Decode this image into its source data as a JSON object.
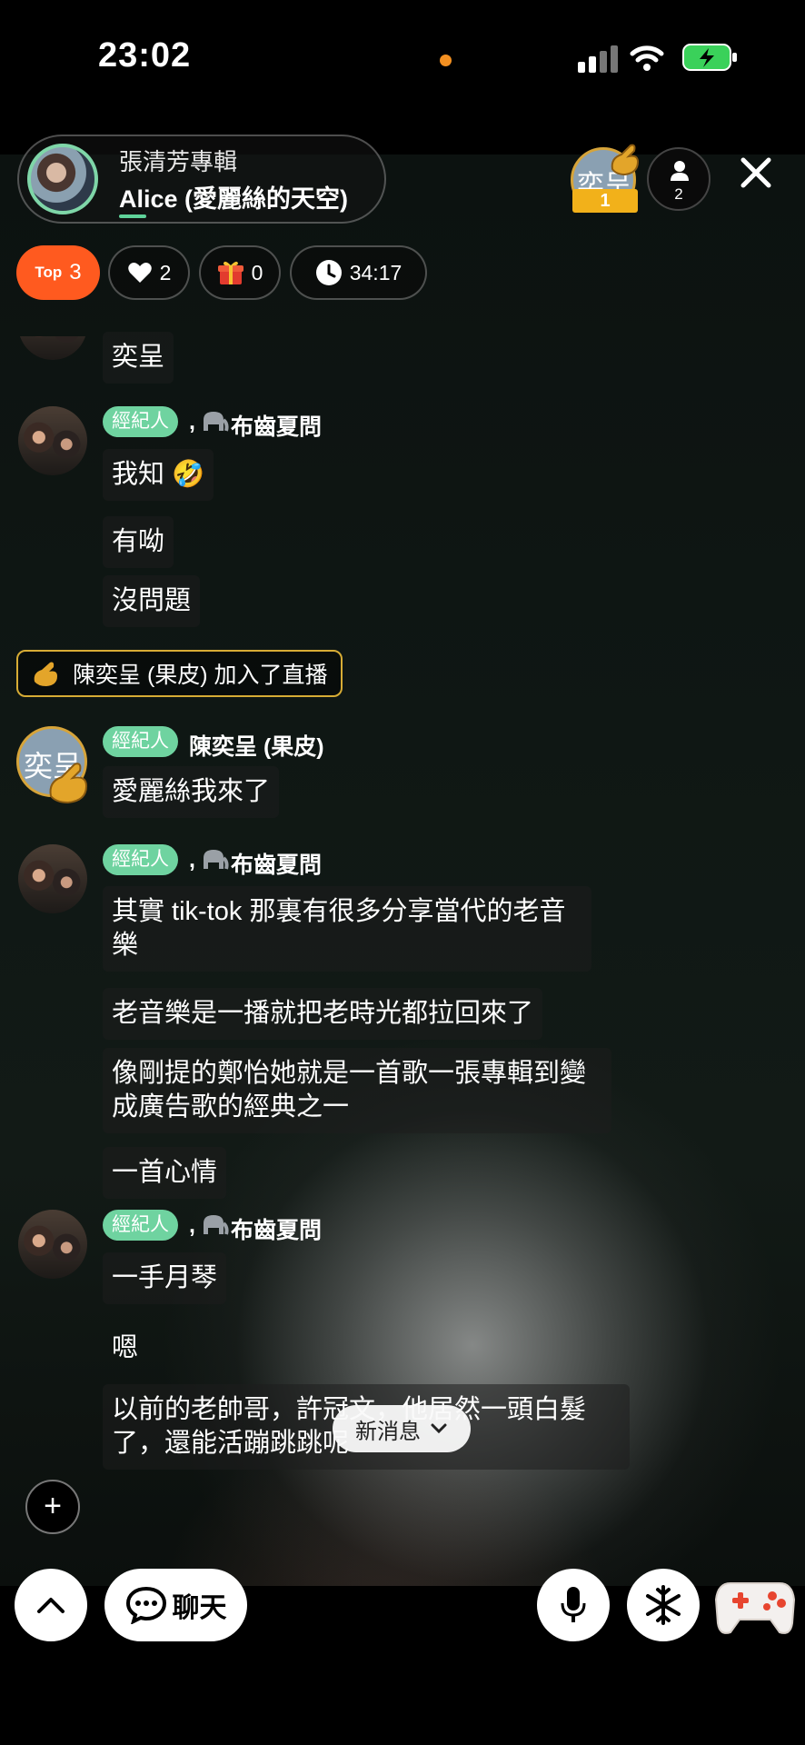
{
  "status_bar": {
    "time": "23:02"
  },
  "header": {
    "album_title": "張清芳專輯",
    "room_name": "Alice (愛麗絲的天空)",
    "viewer_avatar_text": "奕呈",
    "viewer_rank": "1",
    "viewer_count": "2"
  },
  "stats": {
    "top_label": "Top",
    "top_value": "3",
    "likes": "2",
    "gifts": "0",
    "timer": "34:17"
  },
  "chat": {
    "partial_message": "奕呈",
    "badge": "經紀人",
    "group1": {
      "name": "布齒夏問",
      "prefix": ",",
      "messages": [
        "我知 🤣",
        "有呦",
        "沒問題"
      ]
    },
    "join_notice": "陳奕呈 (果皮) 加入了直播",
    "group2": {
      "name": "陳奕呈 (果皮)",
      "avatar_text": "奕呈",
      "messages": [
        "愛麗絲我來了"
      ]
    },
    "group3": {
      "name": "布齒夏問",
      "prefix": ",",
      "messages": [
        "其實 tik-tok 那裏有很多分享當代的老音樂",
        "老音樂是一播就把老時光都拉回來了",
        "像剛提的鄭怡她就是一首歌一張專輯到變成廣告歌的經典之一",
        "一首心情"
      ]
    },
    "group4": {
      "name": "布齒夏問",
      "prefix": ",",
      "messages": [
        "一手月琴",
        "嗯",
        "以前的老帥哥，許冠文，他居然一頭白髮了，還能活蹦跳跳呢"
      ]
    }
  },
  "new_message_label": "新消息",
  "toolbar": {
    "chat_label": "聊天"
  },
  "colors": {
    "accent_green": "#6fd3a0",
    "top_orange": "#ff5a1f",
    "gold": "#d7ac35"
  }
}
